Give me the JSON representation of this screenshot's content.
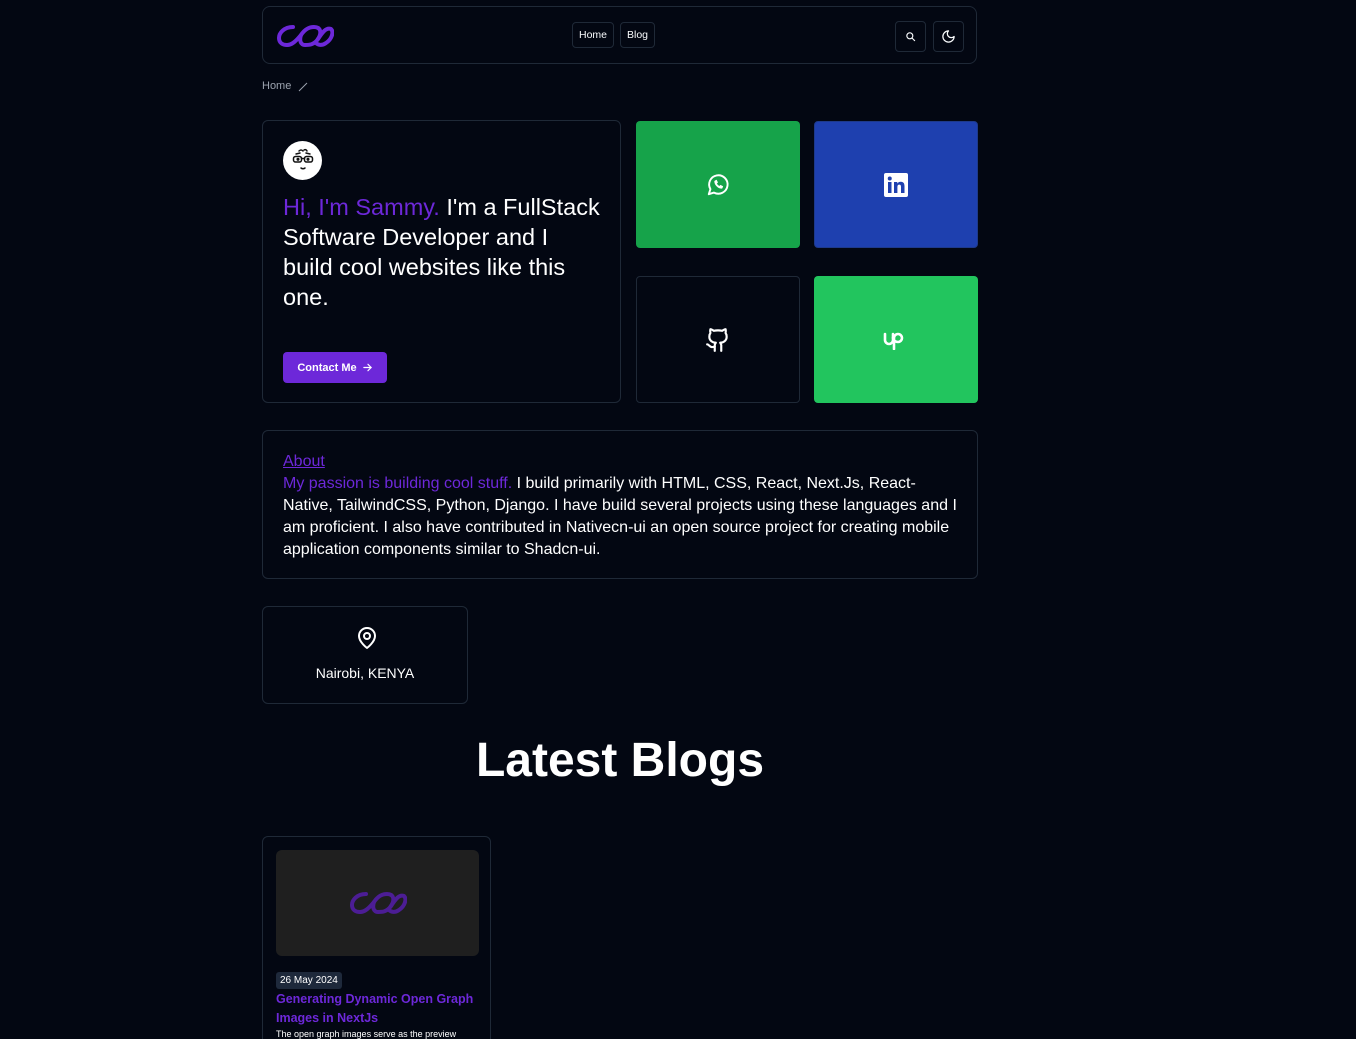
{
  "header": {
    "logo_icon": "infinity-logo-icon",
    "nav": [
      {
        "label": "Home"
      },
      {
        "label": "Blog"
      }
    ],
    "search_icon": "search-icon",
    "theme_icon": "moon-icon"
  },
  "breadcrumb": {
    "items": [
      "Home"
    ],
    "separator_icon": "slash-icon"
  },
  "hero": {
    "avatar_icon": "glasses-face-avatar-icon",
    "greeting": "Hi, I'm Sammy.",
    "text": " I'm a FullStack Software Developer and I build cool websites like this one.",
    "contact_label": "Contact Me",
    "contact_icon": "arrow-right-icon"
  },
  "socials": [
    {
      "name": "whatsapp",
      "icon": "whatsapp-icon",
      "color": "#16a34a"
    },
    {
      "name": "linkedin",
      "icon": "linkedin-icon",
      "color": "#1e40af"
    },
    {
      "name": "github",
      "icon": "github-icon",
      "color": "#030712"
    },
    {
      "name": "upwork",
      "icon": "upwork-icon",
      "color": "#22c55e"
    }
  ],
  "about": {
    "title": "About",
    "highlight": "My passion is building cool stuff.",
    "body": " I build primarily with HTML, CSS, React, Next.Js, React-Native, TailwindCSS, Python, Django. I have build several projects using these languages and I am proficient. I also have contributed in Nativecn-ui an open source project for creating mobile application components similar to Shadcn-ui."
  },
  "location": {
    "icon": "map-pin-icon",
    "text": "Nairobi, KENYA"
  },
  "blogs": {
    "heading": "Latest Blogs",
    "posts": [
      {
        "date": "26 May 2024",
        "title": "Generating Dynamic Open Graph Images in NextJs",
        "excerpt": "The open graph images serve as the preview"
      }
    ]
  },
  "colors": {
    "accent": "#6d28d9",
    "background": "#030712",
    "border": "#1f2937"
  }
}
